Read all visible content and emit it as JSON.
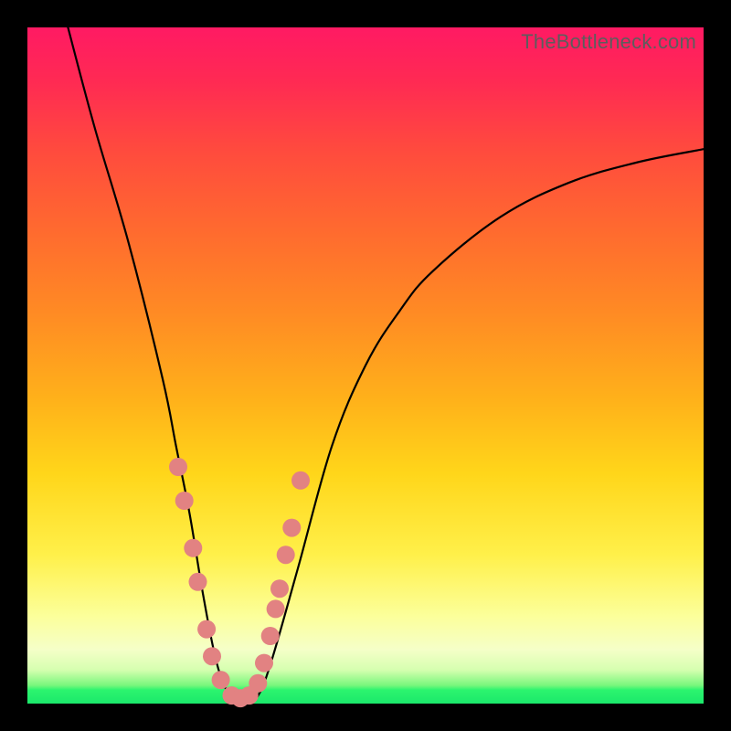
{
  "watermark": "TheBottleneck.com",
  "colors": {
    "background": "#000000",
    "gradient_top": "#ff1a63",
    "gradient_mid": "#ffd61a",
    "gradient_bottom": "#1be86b",
    "curve": "#000000",
    "dots": "#e28282"
  },
  "chart_data": {
    "type": "line",
    "title": "",
    "xlabel": "",
    "ylabel": "",
    "xlim": [
      0,
      100
    ],
    "ylim": [
      0,
      100
    ],
    "note": "No axis ticks/labels are rendered; values are estimated as percentages of plot width/height. y is bottleneck percentage (top=100, bottom=0).",
    "series": [
      {
        "name": "bottleneck-curve",
        "x": [
          6,
          10,
          15,
          20,
          22,
          24,
          26,
          28,
          30,
          32,
          34,
          36,
          40,
          45,
          50,
          55,
          60,
          70,
          80,
          90,
          100
        ],
        "y": [
          100,
          85,
          68,
          48,
          38,
          28,
          16,
          6,
          1,
          0,
          1,
          6,
          20,
          38,
          50,
          58,
          64,
          72,
          77,
          80,
          82
        ]
      }
    ],
    "markers": {
      "name": "highlight-dots",
      "note": "Salmon dots clustered near trough of curve (roughly x≈22 to x≈40).",
      "points": [
        {
          "x": 22.3,
          "y": 35
        },
        {
          "x": 23.2,
          "y": 30
        },
        {
          "x": 24.5,
          "y": 23
        },
        {
          "x": 25.2,
          "y": 18
        },
        {
          "x": 26.5,
          "y": 11
        },
        {
          "x": 27.3,
          "y": 7
        },
        {
          "x": 28.6,
          "y": 3.5
        },
        {
          "x": 30.2,
          "y": 1.2
        },
        {
          "x": 31.5,
          "y": 0.8
        },
        {
          "x": 32.8,
          "y": 1.2
        },
        {
          "x": 34.1,
          "y": 3
        },
        {
          "x": 35.0,
          "y": 6
        },
        {
          "x": 35.9,
          "y": 10
        },
        {
          "x": 36.7,
          "y": 14
        },
        {
          "x": 37.3,
          "y": 17
        },
        {
          "x": 38.2,
          "y": 22
        },
        {
          "x": 39.1,
          "y": 26
        },
        {
          "x": 40.4,
          "y": 33
        }
      ]
    }
  }
}
